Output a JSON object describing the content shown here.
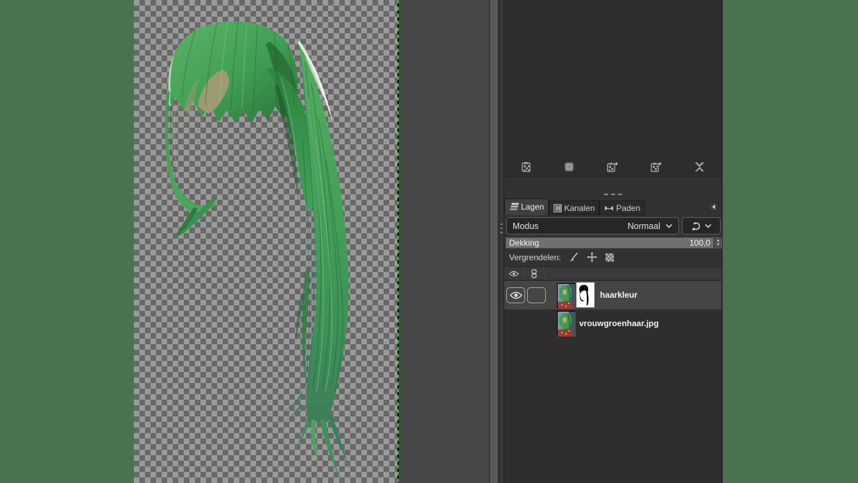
{
  "app": "GIMP",
  "canvas": {
    "content": "green hair cutout on transparent checkerboard",
    "layer_boundary_color": "#2ec82e",
    "checker_light": "#9a9a9a",
    "checker_dark": "#686868",
    "hair_green": "#3f9e52",
    "hair_dark_green": "#2a7036",
    "hair_highlight": "#eef3ec"
  },
  "buffers_panel": {
    "buttons": [
      {
        "icon": "clipboard-checker-icon"
      },
      {
        "icon": "blurred-thumbnail-icon"
      },
      {
        "icon": "clipboard-new-icon"
      },
      {
        "icon": "clipboard-duplicate-icon"
      },
      {
        "icon": "delete-x-icon"
      }
    ]
  },
  "tabs": [
    {
      "label": "Lagen",
      "active": true,
      "icon": "layers-icon"
    },
    {
      "label": "Kanalen",
      "active": false,
      "icon": "channels-icon"
    },
    {
      "label": "Paden",
      "active": false,
      "icon": "paths-icon"
    }
  ],
  "mode_row": {
    "label": "Modus",
    "value": "Normaal"
  },
  "opacity_row": {
    "label": "Dekking",
    "value": "100,0"
  },
  "lock_row": {
    "label": "Vergrendelen:",
    "icons": [
      "paintbrush-icon",
      "move-cross-icon",
      "alpha-checker-icon"
    ]
  },
  "list_header": {
    "icons": [
      "eye-icon",
      "chain-link-icon"
    ]
  },
  "layers": [
    {
      "name": "haarkleur",
      "selected": true,
      "visible": true,
      "linked": false,
      "has_mask": true
    },
    {
      "name": "vrouwgroenhaar.jpg",
      "selected": false,
      "visible": false,
      "linked": false,
      "has_mask": false
    }
  ],
  "colors": {
    "desktop_green": "#49734f",
    "dock_bg": "#323232",
    "panel_bg": "#2d2d2d",
    "selected_row": "#454545",
    "button_bg": "#262626",
    "opacity_fill": "#707070"
  }
}
